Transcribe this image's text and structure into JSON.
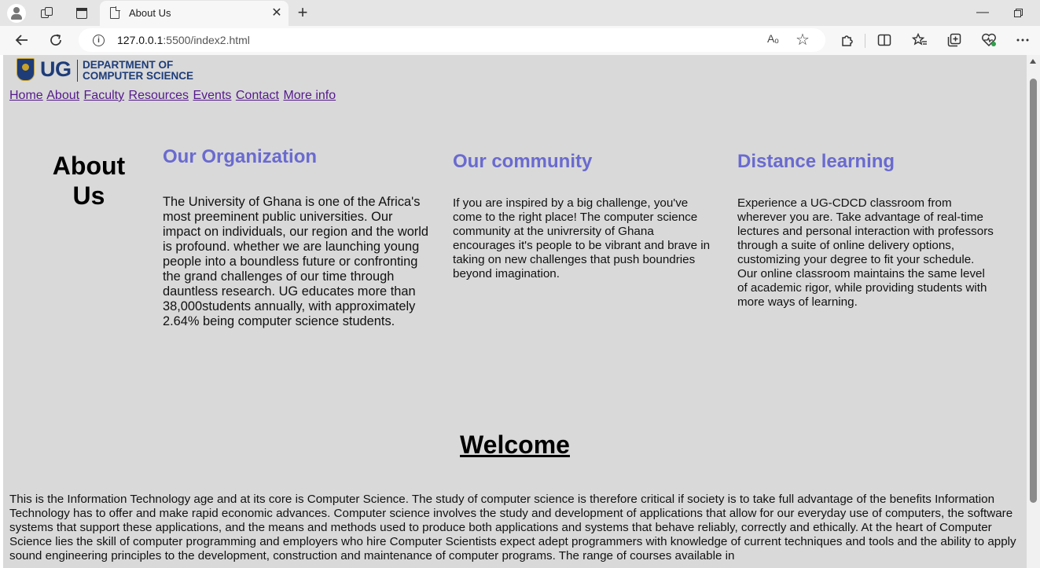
{
  "browser": {
    "tab_title": "About Us",
    "tab_close": "✕",
    "new_tab": "+",
    "url_host": "127.0.0.1",
    "url_rest": ":5500/index2.html",
    "read_aloud": "Aₒ",
    "window_min": "—",
    "icons": [
      "profile-icon",
      "workspaces-icon",
      "tab-actions-icon",
      "page-icon",
      "back-icon",
      "refresh-icon",
      "info-icon",
      "read-aloud-icon",
      "favorite-star-icon",
      "extensions-icon",
      "split-screen-icon",
      "favorites-icon",
      "collections-icon",
      "browser-essentials-icon",
      "more-icon"
    ]
  },
  "logo": {
    "ug": "UG",
    "dept_line1": "DEPARTMENT OF",
    "dept_line2": "COMPUTER SCIENCE"
  },
  "nav": [
    "Home",
    "About",
    "Faculty",
    "Resources",
    "Events",
    "Contact",
    "More info"
  ],
  "about_heading": "About Us",
  "columns": [
    {
      "title": "Our Organization",
      "text": "The University of Ghana is one of the Africa's most preeminent public universities. Our impact on individuals, our region and the world is profound. whether we are launching young people into a boundless future or confronting the grand challenges of our time through dauntless research. UG educates more than 38,000students annually, with approximately 2.64% being computer science students."
    },
    {
      "title": "Our community",
      "text": "If you are inspired by a big challenge, you've come to the right place! The computer science community at the univrersity of Ghana encourages it's people to be vibrant and brave in taking on new challenges that push boundries beyond imagination."
    },
    {
      "title": "Distance learning",
      "text": "Experience a UG-CDCD classroom from wherever you are. Take advantage of real-time lectures and personal interaction with professors through a suite of online delivery options, customizing your degree to fit your schedule. Our online classroom maintains the same level of academic rigor, while providing students with more ways of learning."
    }
  ],
  "welcome": "Welcome",
  "intro": "This is the Information Technology age and at its core is Computer Science. The study of computer science is therefore critical if society is to take full advantage of the benefits Information Technology has to offer and make rapid economic advances. Computer science involves the study and development of applications that allow for our everyday use of computers, the software systems that support these applications, and the means and methods used to produce both applications and systems that behave reliably, correctly and ethically. At the heart of Computer Science lies the skill of computer programming and employers who hire Computer Scientists expect adept programmers with knowledge of current techniques and tools and the ability to apply sound engineering principles to the development, construction and maintenance of computer programs. The range of courses available in"
}
